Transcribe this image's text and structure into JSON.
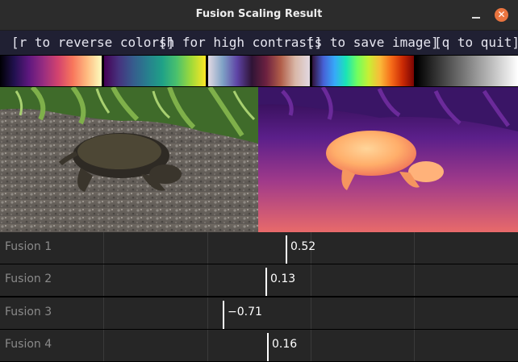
{
  "window": {
    "title": "Fusion Scaling Result",
    "close_glyph": "✕",
    "buttons": [
      "minimize-icon",
      "close-icon"
    ],
    "close_color": "#e9743f"
  },
  "help": {
    "reverse": "[r to reverse colors]",
    "contrast": "[h for high contrast]",
    "save": "[s to save image]",
    "quit": "[q to quit]"
  },
  "colormaps": [
    "magma",
    "viridis",
    "twilight",
    "turbo",
    "gray"
  ],
  "images": {
    "left": "photo of a snapping turtle on gravel with green plants behind",
    "right": "depth map of the same scene in magma-style colors"
  },
  "fusion": [
    {
      "label": "Fusion 1",
      "value": 0.52,
      "display": "0.52"
    },
    {
      "label": "Fusion 2",
      "value": 0.13,
      "display": "0.13"
    },
    {
      "label": "Fusion 3",
      "value": -0.71,
      "display": "−0.71"
    },
    {
      "label": "Fusion 4",
      "value": 0.16,
      "display": "0.16"
    }
  ]
}
